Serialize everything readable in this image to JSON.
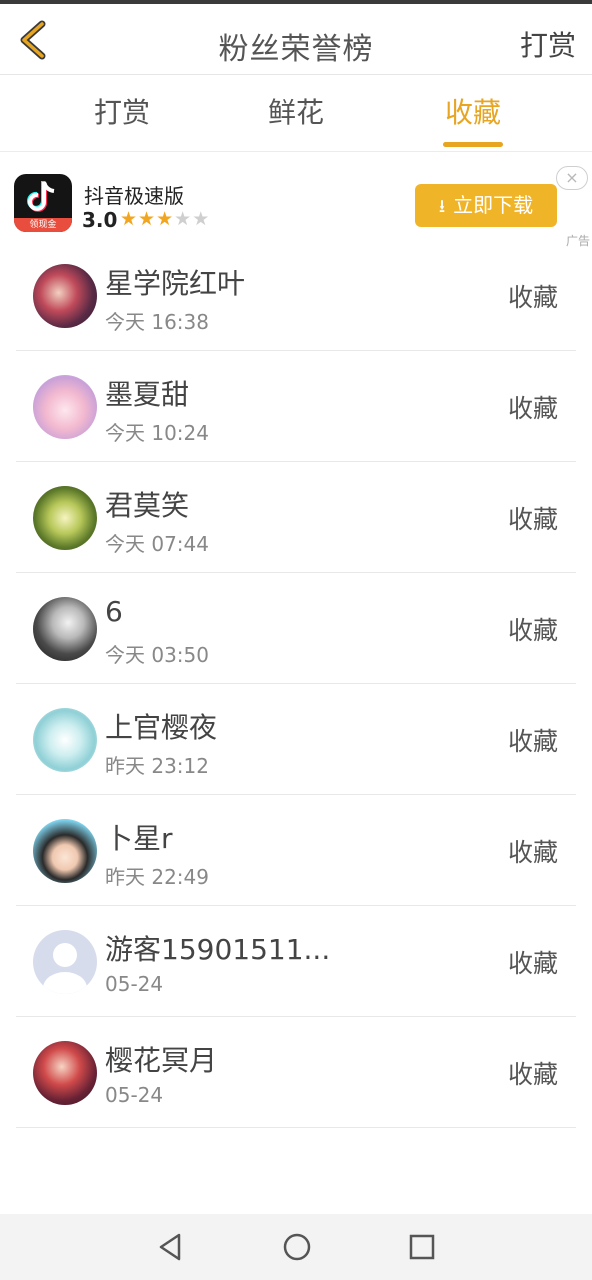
{
  "header": {
    "title": "粉丝荣誉榜",
    "action_label": "打赏"
  },
  "tabs": [
    {
      "label": "打赏",
      "active": false
    },
    {
      "label": "鲜花",
      "active": false
    },
    {
      "label": "收藏",
      "active": true
    }
  ],
  "ad": {
    "app_name": "抖音极速版",
    "rating": "3.0",
    "stars": "★★★★★",
    "stars_filled": 3,
    "logo_badge": "领现金",
    "download_label": "立即下载",
    "close_symbol": "×",
    "ad_label": "广告"
  },
  "users": [
    {
      "name": "星学院红叶",
      "time": "今天 16:38",
      "action": "收藏"
    },
    {
      "name": "墨夏甜",
      "time": "今天 10:24",
      "action": "收藏"
    },
    {
      "name": "君莫笑",
      "time": "今天 07:44",
      "action": "收藏"
    },
    {
      "name": "6",
      "time": "今天 03:50",
      "action": "收藏"
    },
    {
      "name": "上官樱夜",
      "time": "昨天 23:12",
      "action": "收藏"
    },
    {
      "name": "卜星r",
      "time": "昨天 22:49",
      "action": "收藏"
    },
    {
      "name": "游客15901511...",
      "time": "05-24",
      "action": "收藏"
    },
    {
      "name": "樱花冥月",
      "time": "05-24",
      "action": "收藏"
    }
  ],
  "colors": {
    "accent": "#e7a521",
    "download_button": "#f0b429",
    "star": "#f2a51e"
  },
  "icons": {
    "back": "chevron-left-icon",
    "nav_back": "triangle-back-icon",
    "nav_home": "circle-home-icon",
    "nav_recent": "square-recent-icon"
  }
}
